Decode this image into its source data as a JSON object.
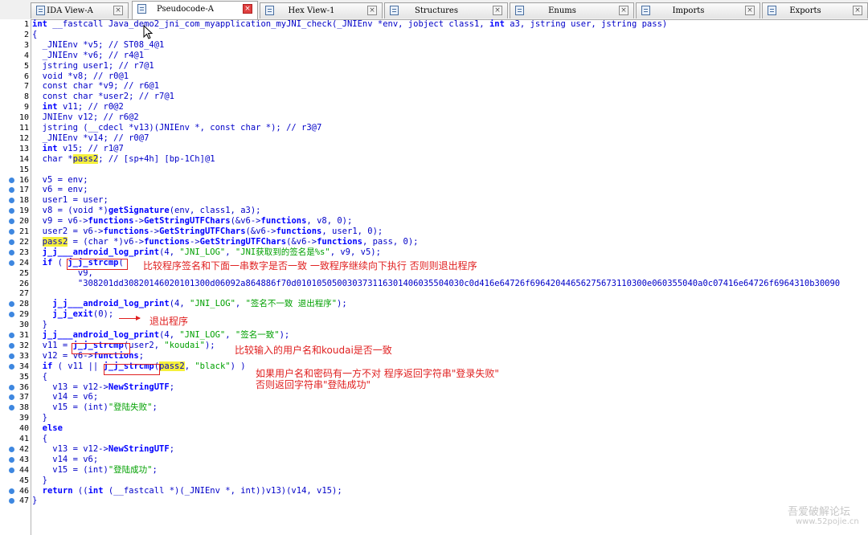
{
  "tabs": [
    {
      "label": "IDA View-A",
      "active": false,
      "icon": "ida-view-icon"
    },
    {
      "label": "Pseudocode-A",
      "active": true,
      "icon": "pseudocode-icon"
    },
    {
      "label": "Hex View-1",
      "active": false,
      "icon": "hex-view-icon"
    },
    {
      "label": "Structures",
      "active": false,
      "icon": "structures-icon"
    },
    {
      "label": "Enums",
      "active": false,
      "icon": "enums-icon"
    },
    {
      "label": "Imports",
      "active": false,
      "icon": "imports-icon"
    },
    {
      "label": "Exports",
      "active": false,
      "icon": "exports-icon"
    }
  ],
  "code": [
    {
      "n": "1",
      "bp": false,
      "t": "int __fastcall Java_demo2_jni_com_myapplication_myJNI_check(_JNIEnv *env, jobject class1, int a3, jstring user, jstring pass)"
    },
    {
      "n": "2",
      "bp": false,
      "t": "{"
    },
    {
      "n": "3",
      "bp": false,
      "t": "  _JNIEnv *v5; // ST08_4@1"
    },
    {
      "n": "4",
      "bp": false,
      "t": "  _JNIEnv *v6; // r4@1"
    },
    {
      "n": "5",
      "bp": false,
      "t": "  jstring user1; // r7@1"
    },
    {
      "n": "6",
      "bp": false,
      "t": "  void *v8; // r0@1"
    },
    {
      "n": "7",
      "bp": false,
      "t": "  const char *v9; // r6@1"
    },
    {
      "n": "8",
      "bp": false,
      "t": "  const char *user2; // r7@1"
    },
    {
      "n": "9",
      "bp": false,
      "t": "  int v11; // r0@2"
    },
    {
      "n": "10",
      "bp": false,
      "t": "  JNIEnv v12; // r6@2"
    },
    {
      "n": "11",
      "bp": false,
      "t": "  jstring (__cdecl *v13)(JNIEnv *, const char *); // r3@7"
    },
    {
      "n": "12",
      "bp": false,
      "t": "  _JNIEnv *v14; // r0@7"
    },
    {
      "n": "13",
      "bp": false,
      "t": "  int v15; // r1@7"
    },
    {
      "n": "14",
      "bp": false,
      "t": "  char *pass2; // [sp+4h] [bp-1Ch]@1"
    },
    {
      "n": "15",
      "bp": false,
      "t": ""
    },
    {
      "n": "16",
      "bp": true,
      "t": "  v5 = env;"
    },
    {
      "n": "17",
      "bp": true,
      "t": "  v6 = env;"
    },
    {
      "n": "18",
      "bp": true,
      "t": "  user1 = user;"
    },
    {
      "n": "19",
      "bp": true,
      "t": "  v8 = (void *)getSignature(env, class1, a3);"
    },
    {
      "n": "20",
      "bp": true,
      "t": "  v9 = v6->functions->GetStringUTFChars(&v6->functions, v8, 0);"
    },
    {
      "n": "21",
      "bp": true,
      "t": "  user2 = v6->functions->GetStringUTFChars(&v6->functions, user1, 0);"
    },
    {
      "n": "22",
      "bp": true,
      "t": "  pass2 = (char *)v6->functions->GetStringUTFChars(&v6->functions, pass, 0);"
    },
    {
      "n": "23",
      "bp": true,
      "t": "  j_j___android_log_print(4, \"JNI_LOG\", \"JNI获取到的签名是%s\", v9, v5);"
    },
    {
      "n": "24",
      "bp": true,
      "t": "  if ( j_j_strcmp("
    },
    {
      "n": "25",
      "bp": false,
      "t": "         v9,"
    },
    {
      "n": "26",
      "bp": false,
      "t": "         \"308201dd30820146020101300d06092a864886f70d010105050030373116301406035504030c0d416e64726f69642044656275673110300e060355040a0c07416e64726f6964310b30090"
    },
    {
      "n": "27",
      "bp": false,
      "t": ""
    },
    {
      "n": "28",
      "bp": true,
      "t": "    j_j___android_log_print(4, \"JNI_LOG\", \"签名不一致 退出程序\");"
    },
    {
      "n": "29",
      "bp": true,
      "t": "    j_j_exit(0);"
    },
    {
      "n": "30",
      "bp": false,
      "t": "  }"
    },
    {
      "n": "31",
      "bp": true,
      "t": "  j_j___android_log_print(4, \"JNI_LOG\", \"签名一致\");"
    },
    {
      "n": "32",
      "bp": true,
      "t": "  v11 = j_j_strcmp(user2, \"koudai\");"
    },
    {
      "n": "33",
      "bp": true,
      "t": "  v12 = v6->functions;"
    },
    {
      "n": "34",
      "bp": true,
      "t": "  if ( v11 || j_j_strcmp(pass2, \"black\") )"
    },
    {
      "n": "35",
      "bp": false,
      "t": "  {"
    },
    {
      "n": "36",
      "bp": true,
      "t": "    v13 = v12->NewStringUTF;"
    },
    {
      "n": "37",
      "bp": true,
      "t": "    v14 = v6;"
    },
    {
      "n": "38",
      "bp": true,
      "t": "    v15 = (int)\"登陆失败\";"
    },
    {
      "n": "39",
      "bp": false,
      "t": "  }"
    },
    {
      "n": "40",
      "bp": false,
      "t": "  else"
    },
    {
      "n": "41",
      "bp": false,
      "t": "  {"
    },
    {
      "n": "42",
      "bp": true,
      "t": "    v13 = v12->NewStringUTF;"
    },
    {
      "n": "43",
      "bp": true,
      "t": "    v14 = v6;"
    },
    {
      "n": "44",
      "bp": true,
      "t": "    v15 = (int)\"登陆成功\";"
    },
    {
      "n": "45",
      "bp": false,
      "t": "  }"
    },
    {
      "n": "46",
      "bp": true,
      "t": "  return ((int (__fastcall *)(_JNIEnv *, int))v13)(v14, v15);"
    },
    {
      "n": "47",
      "bp": true,
      "t": "}"
    }
  ],
  "annotations": {
    "note_strcmp_sig": "比较程序签名和下面一串数字是否一致 一致程序继续向下执行 否则则退出程序",
    "note_exit": "退出程序",
    "note_user": "比较输入的用户名和koudai是否一致",
    "note_cond_1": "如果用户名和密码有一方不对 程序返回字符串\"登录失败\"",
    "note_cond_2": "否则返回字符串\"登陆成功\""
  },
  "watermark": {
    "line1": "吾爱破解论坛",
    "line2": "www.52pojie.cn"
  },
  "colors": {
    "code": "#0000c8",
    "string": "#00a000",
    "highlight": "#f5f03a",
    "annotation": "#e02020",
    "breakpoint": "#3e87e0"
  }
}
